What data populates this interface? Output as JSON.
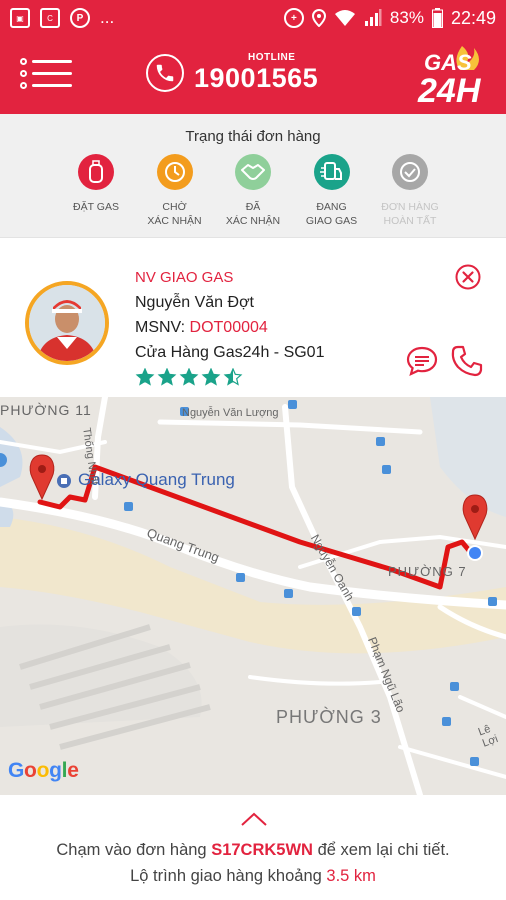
{
  "status_bar": {
    "battery": "83%",
    "time": "22:49",
    "more": "..."
  },
  "header": {
    "hotline_label": "HOTLINE",
    "hotline_number": "19001565",
    "logo_top": "GAS",
    "logo_bottom": "24H",
    "brand_color": "#e2233f"
  },
  "order_status": {
    "title": "Trạng thái đơn hàng",
    "steps": [
      {
        "label_1": "ĐẶT GAS",
        "label_2": "",
        "color": "#e2233f",
        "icon": "gas-cylinder-icon"
      },
      {
        "label_1": "CHỜ",
        "label_2": "XÁC NHẬN",
        "color": "#f39c1d",
        "icon": "clock-icon"
      },
      {
        "label_1": "ĐÃ",
        "label_2": "XÁC NHẬN",
        "color": "#8fcf9a",
        "icon": "handshake-icon"
      },
      {
        "label_1": "ĐANG",
        "label_2": "GIAO GAS",
        "color": "#1aa38a",
        "icon": "delivery-icon"
      },
      {
        "label_1": "ĐƠN HÀNG",
        "label_2": "HOÀN TẤT",
        "color": "#a7a7a7",
        "icon": "check-icon"
      }
    ]
  },
  "driver": {
    "role": "NV GIAO GAS",
    "name": "Nguyễn Văn Đợt",
    "id_label": "MSNV:",
    "id_value": "DOT00004",
    "store": "Cửa Hàng Gas24h - SG01",
    "rating": 4.5,
    "star_color": "#1aa38a"
  },
  "map": {
    "labels": {
      "phuong_11": "PHƯỜNG 11",
      "galaxy": "Galaxy Quang Trung",
      "nguyen_van_luong": "Nguyễn Văn Lượng",
      "thong_nhat": "Thống Nhất",
      "quang_trung": "Quang Trung",
      "nguyen_oanh": "Nguyễn Oanh",
      "phuong_7": "PHƯỜNG 7",
      "pham_ngu_lao": "Phạm Ngũ Lão",
      "phuong_3": "PHƯỜNG 3",
      "le_loi": "Lê Lợi"
    },
    "google": [
      "G",
      "o",
      "o",
      "g",
      "l",
      "e"
    ],
    "route_color": "#e01414"
  },
  "bottom": {
    "line1_prefix": "Chạm vào đơn hàng",
    "order_code": "S17CRK5WN",
    "line1_suffix": "để xem lại chi tiết.",
    "line2_prefix": "Lộ trình giao hàng khoảng",
    "distance": "3.5 km"
  }
}
